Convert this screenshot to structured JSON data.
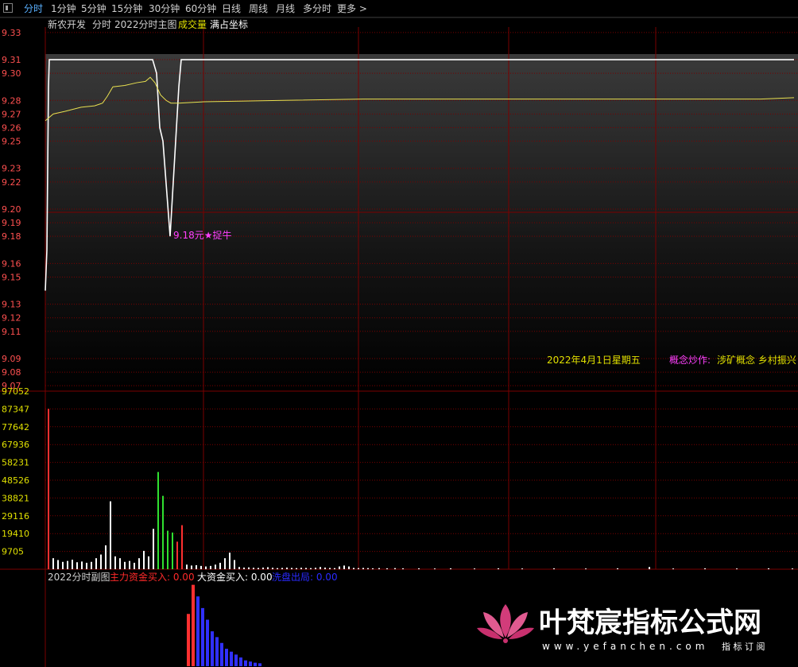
{
  "toolbar": {
    "tabs": [
      {
        "label": "分时",
        "active": true
      },
      {
        "label": "1分钟"
      },
      {
        "label": "5分钟"
      },
      {
        "label": "15分钟"
      },
      {
        "label": "30分钟"
      },
      {
        "label": "60分钟"
      },
      {
        "label": "日线"
      },
      {
        "label": "周线"
      },
      {
        "label": "月线"
      },
      {
        "label": "多分时"
      },
      {
        "label": "更多 >"
      }
    ]
  },
  "header": {
    "stock_name": "新农开发",
    "mode": "分时",
    "main_indicator": "2022分时主图",
    "volume_label": "成交量",
    "scale_label": "满占坐标"
  },
  "annotations": {
    "low_marker": "9.18元★捉牛",
    "date": "2022年4月1日星期五",
    "concept_label": "概念炒作:",
    "concept_value": "涉矿概念 乡村振兴"
  },
  "sub_panel": {
    "title": "2022分时副图",
    "items": [
      {
        "label": "主力资金买入: 0.00",
        "color": "#ff2a2a"
      },
      {
        "label": "大资金买入: 0.00",
        "color": "#ffffff"
      },
      {
        "label": "洗盘出局: 0.00",
        "color": "#2a2aff"
      }
    ]
  },
  "watermark": {
    "brand": "叶梵宸指标公式网",
    "site": "www.yefanchen.com",
    "tagline": "指 标 订 阅"
  },
  "colors": {
    "price_up": "#ff5050",
    "volume_axis": "#e0e000",
    "price_line": "#ffffff",
    "avg_line": "#e8e050",
    "grid": "#7a0000",
    "marker": "#ff40ff"
  },
  "chart_data": [
    {
      "type": "line",
      "y_ticks": [
        "9.33",
        "9.31",
        "9.30",
        "9.28",
        "9.27",
        "9.26",
        "9.25",
        "9.23",
        "9.22",
        "9.20",
        "9.19",
        "9.18",
        "9.16",
        "9.15",
        "9.13",
        "9.12",
        "9.11",
        "9.09",
        "9.08",
        "9.07"
      ],
      "ylim": [
        9.066,
        9.334
      ],
      "series": [
        {
          "name": "price",
          "x": [
            0,
            2,
            4,
            5,
            6,
            8,
            50,
            100,
            135,
            140,
            144,
            148,
            157,
            158,
            168,
            171,
            220,
            360,
            520,
            680,
            830,
            942
          ],
          "y": [
            9.14,
            9.17,
            9.29,
            9.31,
            9.31,
            9.31,
            9.31,
            9.31,
            9.31,
            9.3,
            9.26,
            9.25,
            9.18,
            9.19,
            9.29,
            9.31,
            9.31,
            9.31,
            9.31,
            9.31,
            9.31,
            9.31
          ]
        },
        {
          "name": "average",
          "x": [
            0,
            10,
            25,
            45,
            62,
            72,
            78,
            85,
            100,
            115,
            126,
            132,
            138,
            145,
            152,
            158,
            168,
            200,
            300,
            400,
            500,
            600,
            700,
            800,
            900,
            942
          ],
          "y": [
            9.265,
            9.27,
            9.272,
            9.275,
            9.276,
            9.278,
            9.283,
            9.29,
            9.291,
            9.293,
            9.294,
            9.297,
            9.293,
            9.284,
            9.28,
            9.278,
            9.278,
            9.279,
            9.28,
            9.281,
            9.281,
            9.281,
            9.281,
            9.281,
            9.281,
            9.282
          ]
        }
      ]
    },
    {
      "type": "bar",
      "y_ticks": [
        "97052",
        "87347",
        "77642",
        "67936",
        "58231",
        "48526",
        "38821",
        "29116",
        "19410",
        "9705"
      ],
      "ylim": [
        0,
        97052
      ],
      "bars": [
        {
          "x": 4,
          "v": 87347,
          "c": "r"
        },
        {
          "x": 10,
          "v": 6000,
          "c": "w"
        },
        {
          "x": 16,
          "v": 5000,
          "c": "w"
        },
        {
          "x": 22,
          "v": 4000,
          "c": "w"
        },
        {
          "x": 28,
          "v": 4500,
          "c": "w"
        },
        {
          "x": 34,
          "v": 5200,
          "c": "w"
        },
        {
          "x": 40,
          "v": 3800,
          "c": "w"
        },
        {
          "x": 46,
          "v": 4200,
          "c": "w"
        },
        {
          "x": 52,
          "v": 3500,
          "c": "w"
        },
        {
          "x": 58,
          "v": 4000,
          "c": "w"
        },
        {
          "x": 64,
          "v": 6000,
          "c": "w"
        },
        {
          "x": 70,
          "v": 8000,
          "c": "w"
        },
        {
          "x": 76,
          "v": 13000,
          "c": "w"
        },
        {
          "x": 82,
          "v": 37000,
          "c": "w"
        },
        {
          "x": 88,
          "v": 7000,
          "c": "w"
        },
        {
          "x": 94,
          "v": 6000,
          "c": "w"
        },
        {
          "x": 100,
          "v": 4000,
          "c": "w"
        },
        {
          "x": 106,
          "v": 4500,
          "c": "w"
        },
        {
          "x": 112,
          "v": 3500,
          "c": "w"
        },
        {
          "x": 118,
          "v": 6000,
          "c": "w"
        },
        {
          "x": 124,
          "v": 10000,
          "c": "w"
        },
        {
          "x": 130,
          "v": 7000,
          "c": "w"
        },
        {
          "x": 136,
          "v": 22000,
          "c": "w"
        },
        {
          "x": 142,
          "v": 53000,
          "c": "g"
        },
        {
          "x": 148,
          "v": 40000,
          "c": "g"
        },
        {
          "x": 154,
          "v": 21000,
          "c": "g"
        },
        {
          "x": 160,
          "v": 20000,
          "c": "g"
        },
        {
          "x": 166,
          "v": 15000,
          "c": "r"
        },
        {
          "x": 172,
          "v": 24000,
          "c": "r"
        },
        {
          "x": 178,
          "v": 2500,
          "c": "w"
        },
        {
          "x": 184,
          "v": 2000,
          "c": "w"
        },
        {
          "x": 190,
          "v": 2200,
          "c": "w"
        },
        {
          "x": 196,
          "v": 1800,
          "c": "w"
        },
        {
          "x": 202,
          "v": 1500,
          "c": "w"
        },
        {
          "x": 208,
          "v": 1800,
          "c": "w"
        },
        {
          "x": 214,
          "v": 2500,
          "c": "w"
        },
        {
          "x": 220,
          "v": 3500,
          "c": "w"
        },
        {
          "x": 226,
          "v": 6000,
          "c": "w"
        },
        {
          "x": 232,
          "v": 9000,
          "c": "w"
        },
        {
          "x": 238,
          "v": 5000,
          "c": "w"
        },
        {
          "x": 244,
          "v": 1200,
          "c": "w"
        },
        {
          "x": 250,
          "v": 900,
          "c": "w"
        },
        {
          "x": 256,
          "v": 1000,
          "c": "w"
        },
        {
          "x": 262,
          "v": 800,
          "c": "w"
        },
        {
          "x": 268,
          "v": 700,
          "c": "w"
        },
        {
          "x": 274,
          "v": 900,
          "c": "w"
        },
        {
          "x": 280,
          "v": 1100,
          "c": "w"
        },
        {
          "x": 286,
          "v": 800,
          "c": "w"
        },
        {
          "x": 292,
          "v": 600,
          "c": "w"
        },
        {
          "x": 298,
          "v": 700,
          "c": "w"
        },
        {
          "x": 304,
          "v": 900,
          "c": "w"
        },
        {
          "x": 310,
          "v": 700,
          "c": "w"
        },
        {
          "x": 316,
          "v": 600,
          "c": "w"
        },
        {
          "x": 322,
          "v": 800,
          "c": "w"
        },
        {
          "x": 328,
          "v": 700,
          "c": "w"
        },
        {
          "x": 334,
          "v": 600,
          "c": "w"
        },
        {
          "x": 340,
          "v": 800,
          "c": "w"
        },
        {
          "x": 346,
          "v": 1200,
          "c": "w"
        },
        {
          "x": 352,
          "v": 900,
          "c": "w"
        },
        {
          "x": 358,
          "v": 700,
          "c": "w"
        },
        {
          "x": 364,
          "v": 600,
          "c": "w"
        },
        {
          "x": 370,
          "v": 1500,
          "c": "w"
        },
        {
          "x": 376,
          "v": 2000,
          "c": "w"
        },
        {
          "x": 382,
          "v": 1500,
          "c": "w"
        },
        {
          "x": 388,
          "v": 700,
          "c": "w"
        },
        {
          "x": 394,
          "v": 600,
          "c": "w"
        },
        {
          "x": 400,
          "v": 700,
          "c": "w"
        },
        {
          "x": 406,
          "v": 600,
          "c": "w"
        },
        {
          "x": 412,
          "v": 500,
          "c": "w"
        },
        {
          "x": 420,
          "v": 600,
          "c": "w"
        },
        {
          "x": 430,
          "v": 500,
          "c": "w"
        },
        {
          "x": 440,
          "v": 600,
          "c": "w"
        },
        {
          "x": 450,
          "v": 500,
          "c": "w"
        },
        {
          "x": 470,
          "v": 500,
          "c": "w"
        },
        {
          "x": 490,
          "v": 400,
          "c": "w"
        },
        {
          "x": 510,
          "v": 500,
          "c": "w"
        },
        {
          "x": 540,
          "v": 400,
          "c": "w"
        },
        {
          "x": 570,
          "v": 500,
          "c": "w"
        },
        {
          "x": 600,
          "v": 400,
          "c": "w"
        },
        {
          "x": 640,
          "v": 500,
          "c": "w"
        },
        {
          "x": 680,
          "v": 400,
          "c": "w"
        },
        {
          "x": 720,
          "v": 500,
          "c": "w"
        },
        {
          "x": 760,
          "v": 1200,
          "c": "w"
        },
        {
          "x": 790,
          "v": 400,
          "c": "w"
        },
        {
          "x": 830,
          "v": 500,
          "c": "w"
        },
        {
          "x": 870,
          "v": 400,
          "c": "w"
        },
        {
          "x": 910,
          "v": 500,
          "c": "w"
        },
        {
          "x": 940,
          "v": 400,
          "c": "w"
        }
      ]
    },
    {
      "type": "bar",
      "series": [
        {
          "x": [
            180,
            186
          ],
          "v": [
            9,
            14
          ],
          "c": "r"
        },
        {
          "x": [
            192,
            198,
            204,
            210,
            216,
            222,
            228,
            234,
            240,
            246,
            252,
            258,
            264,
            270
          ],
          "v": [
            12,
            10,
            8,
            6,
            5,
            4,
            3,
            2.5,
            2,
            1.5,
            1,
            0.8,
            0.6,
            0.5
          ],
          "c": "b"
        }
      ],
      "ylim": [
        0,
        16
      ]
    }
  ]
}
